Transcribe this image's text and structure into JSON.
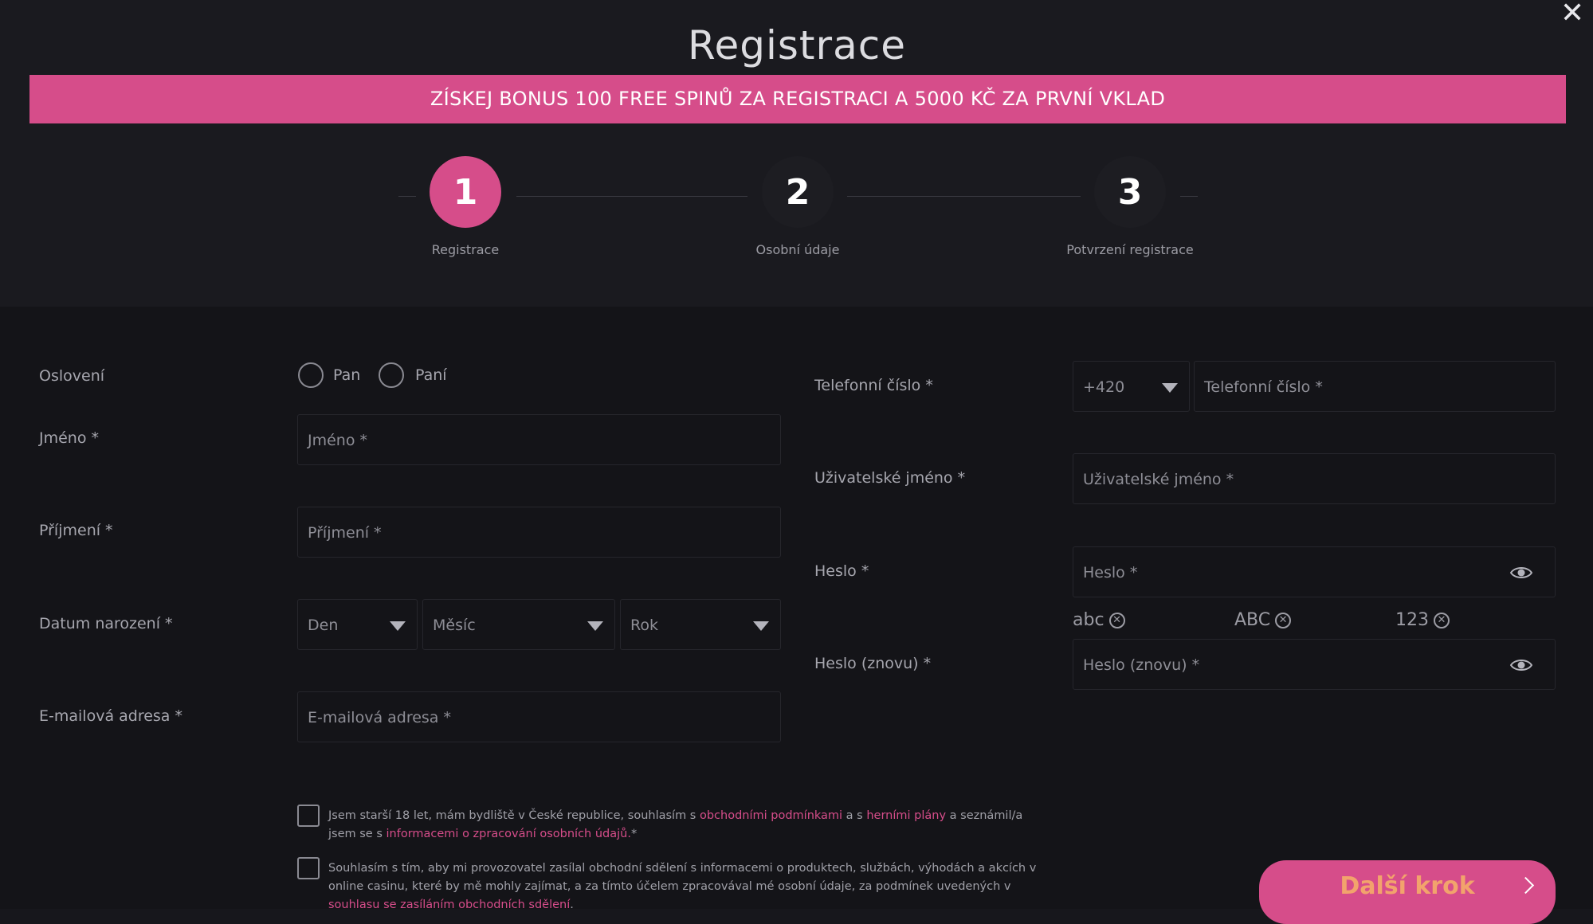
{
  "modal": {
    "title": "Registrace",
    "close_icon": "close-icon",
    "banner": "ZÍSKEJ BONUS 100 FREE SPINŮ ZA REGISTRACI A 5000 KČ ZA PRVNÍ VKLAD"
  },
  "steps": [
    {
      "number": "1",
      "label": "Registrace",
      "active": true
    },
    {
      "number": "2",
      "label": "Osobní údaje",
      "active": false
    },
    {
      "number": "3",
      "label": "Potvrzení registrace",
      "active": false
    }
  ],
  "form_left": {
    "salutation": {
      "label": "Oslovení",
      "options": [
        "Pan",
        "Paní"
      ]
    },
    "first_name": {
      "label": "Jméno *",
      "placeholder": "Jméno *"
    },
    "last_name": {
      "label": "Příjmení *",
      "placeholder": "Příjmení *"
    },
    "birth_date": {
      "label": "Datum narození *",
      "day": "Den",
      "month": "Měsíc",
      "year": "Rok"
    },
    "email": {
      "label": "E-mailová adresa *",
      "placeholder": "E-mailová adresa *"
    }
  },
  "form_right": {
    "phone": {
      "label": "Telefonní číslo *",
      "prefix": "+420",
      "placeholder": "Telefonní číslo *"
    },
    "username": {
      "label": "Uživatelské jméno *",
      "placeholder": "Uživatelské jméno *"
    },
    "password": {
      "label": "Heslo *",
      "placeholder": "Heslo *"
    },
    "password_hints": [
      "abc",
      "ABC",
      "123"
    ],
    "password_repeat": {
      "label": "Heslo (znovu) *",
      "placeholder": "Heslo (znovu) *"
    }
  },
  "consents": {
    "terms": {
      "text1": "Jsem starší 18 let, mám bydliště v České republice, souhlasím s ",
      "link1": "obchodními podmínkami",
      "text2": " a s ",
      "link2": "herními plány",
      "text3": " a seznámil/a jsem se s ",
      "link3": "informacemi o zpracování osobních údajů.",
      "text4": "*"
    },
    "marketing": {
      "text1": "Souhlasím s tím, aby mi provozovatel zasílal obchodní sdělení s informacemi o produktech, službách, výhodách a akcích v online casinu, které by mě mohly zajímat, a za tímto účelem zpracovával mé osobní údaje, za podmínek uvedených v ",
      "link1": "souhlasu se zasíláním obchodních sdělení",
      "text2": "."
    }
  },
  "actions": {
    "next_label": "Další krok"
  },
  "colors": {
    "accent": "#d64d8a",
    "button_text": "#f2a36c",
    "background": "#17171c"
  }
}
